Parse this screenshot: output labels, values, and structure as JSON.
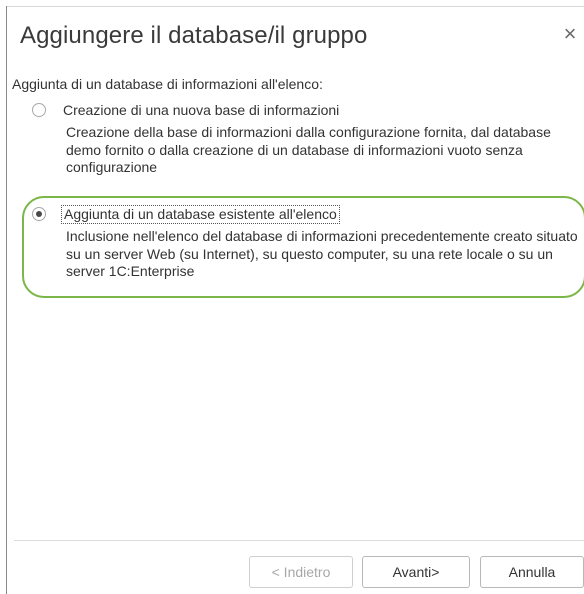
{
  "dialog": {
    "title": "Aggiungere il database/il gruppo",
    "close_icon": "close-icon",
    "close_glyph": "×"
  },
  "prompt": "Aggiunta di un database di informazioni all'elenco:",
  "options": [
    {
      "label": "Creazione di una nuova base di informazioni",
      "description": "Creazione della base di informazioni dalla configurazione fornita, dal database demo fornito o dalla creazione di un database di informazioni vuoto senza configurazione",
      "selected": false
    },
    {
      "label": "Aggiunta di un database esistente all'elenco",
      "description": "Inclusione nell'elenco del database di informazioni precedentemente creato situato su un server Web (su Internet), su questo computer, su una rete locale o su un server 1C:Enterprise",
      "selected": true
    }
  ],
  "buttons": {
    "back": "< Indietro",
    "next": "Avanti>",
    "cancel": "Annulla"
  },
  "colors": {
    "highlight": "#7ab648",
    "text": "#333333",
    "disabled_text": "#a8a8a8"
  }
}
